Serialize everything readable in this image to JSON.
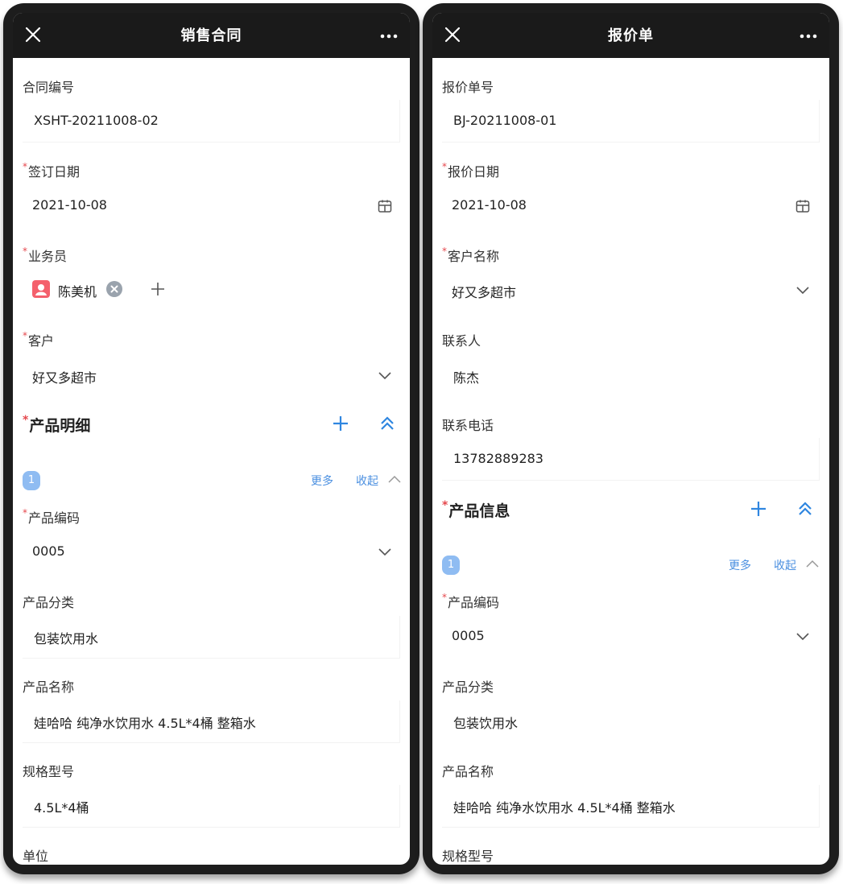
{
  "left": {
    "title": "销售合同",
    "fields": {
      "contract_no_label": "合同编号",
      "contract_no_value": "XSHT-20211008-02",
      "sign_date_label": "签订日期",
      "sign_date_value": "2021-10-08",
      "salesman_label": "业务员",
      "salesman_value": "陈美机",
      "customer_label": "客户",
      "customer_value": "好又多超市"
    },
    "section": {
      "title": "产品明细",
      "item_index": "1",
      "more_label": "更多",
      "collapse_label": "收起"
    },
    "product": {
      "code_label": "产品编码",
      "code_value": "0005",
      "category_label": "产品分类",
      "category_value": "包装饮用水",
      "name_label": "产品名称",
      "name_value": "娃哈哈 纯净水饮用水 4.5L*4桶 整箱水",
      "spec_label": "规格型号",
      "spec_value": "4.5L*4桶",
      "unit_label": "单位"
    }
  },
  "right": {
    "title": "报价单",
    "fields": {
      "quote_no_label": "报价单号",
      "quote_no_value": "BJ-20211008-01",
      "quote_date_label": "报价日期",
      "quote_date_value": "2021-10-08",
      "customer_label": "客户名称",
      "customer_value": "好又多超市",
      "contact_label": "联系人",
      "contact_value": "陈杰",
      "phone_label": "联系电话",
      "phone_value": "13782889283"
    },
    "section": {
      "title": "产品信息",
      "item_index": "1",
      "more_label": "更多",
      "collapse_label": "收起"
    },
    "product": {
      "code_label": "产品编码",
      "code_value": "0005",
      "category_label": "产品分类",
      "category_value": "包装饮用水",
      "name_label": "产品名称",
      "name_value": "娃哈哈 纯净水饮用水 4.5L*4桶 整箱水",
      "spec_label": "规格型号"
    }
  },
  "required_mark": "*",
  "colors": {
    "header_bg": "#1a1a1a",
    "accent": "#2f86e0",
    "link": "#4a8fe0",
    "required": "#e5484d",
    "badge": "#8fbcf2"
  },
  "icons": [
    "close-icon",
    "more-dots-icon",
    "calendar-icon",
    "chevron-down-icon",
    "chevron-up-icon",
    "plus-icon",
    "double-chevron-up-icon",
    "clear-icon",
    "avatar-icon"
  ]
}
